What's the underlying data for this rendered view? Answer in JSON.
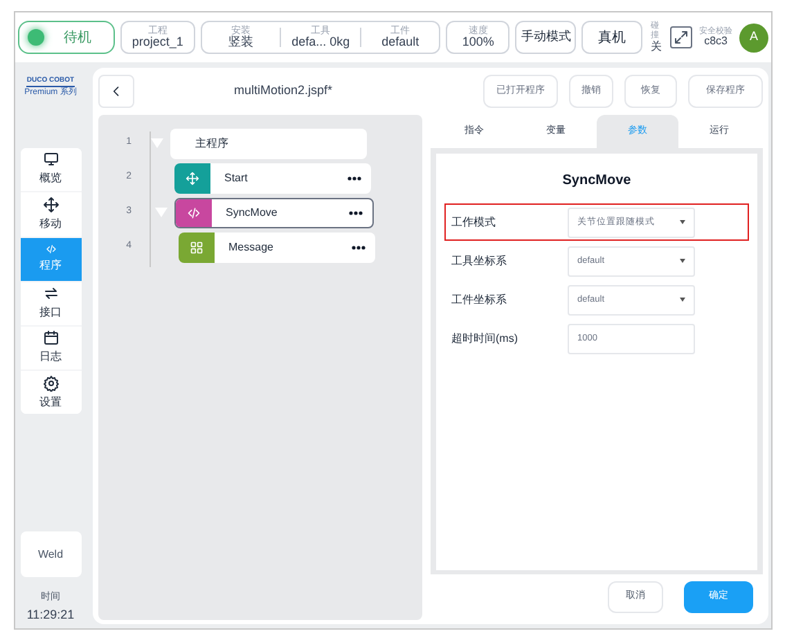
{
  "status_bar": {
    "state": {
      "label": "待机",
      "on": true
    },
    "items": [
      {
        "title": "工程",
        "value": "project_1"
      }
    ],
    "install_group": [
      {
        "title": "安装",
        "value": "竖装"
      },
      {
        "title": "工具",
        "value": "defa...   0kg"
      },
      {
        "title": "工件",
        "value": "default"
      }
    ],
    "speed": {
      "title": "速度",
      "value": "100%"
    },
    "mode_button": "手动模式",
    "machine_button": "真机",
    "collision": {
      "title": "碰撞",
      "value": "关"
    },
    "safety": {
      "title": "安全校验",
      "value": "c8c3"
    },
    "avatar": "A"
  },
  "sidebar": {
    "logo": "DUCO COBOT",
    "logo_sub": "Premium 系列",
    "items": [
      {
        "kind": "overview",
        "label": "概览",
        "selected": false
      },
      {
        "kind": "move",
        "label": "移动",
        "selected": false
      },
      {
        "kind": "program",
        "label": "程序",
        "selected": true
      },
      {
        "kind": "io",
        "label": "接口",
        "selected": false
      },
      {
        "kind": "log",
        "label": "日志",
        "selected": false
      },
      {
        "kind": "settings",
        "label": "设置",
        "selected": false
      }
    ],
    "weld": "Weld",
    "time_label": "时间",
    "time": "11:29:21"
  },
  "editor": {
    "title": "multiMotion2.jspf*",
    "buttons": [
      "已打开程序",
      "撤销",
      "恢复",
      "保存程序"
    ],
    "tree": [
      {
        "line": "1",
        "label": "主程序",
        "kind": "root",
        "expanded": true,
        "selected": false,
        "children": [
          {
            "line": "2",
            "label": "Start",
            "kind": "move",
            "color": "#14a09a",
            "selected": false
          },
          {
            "line": "3",
            "label": "SyncMove",
            "kind": "code",
            "color": "#c8479f",
            "expanded": true,
            "selected": true,
            "children": [
              {
                "line": "4",
                "label": "Message",
                "kind": "message",
                "color": "#7aa833",
                "selected": false
              }
            ]
          }
        ]
      }
    ],
    "tabs": [
      {
        "label": "指令",
        "selected": false
      },
      {
        "label": "变量",
        "selected": false
      },
      {
        "label": "参数",
        "selected": true
      },
      {
        "label": "运行",
        "selected": false
      }
    ],
    "form": {
      "title": "SyncMove",
      "fields": [
        {
          "label": "工作模式",
          "kind": "select",
          "value": "关节位置跟随模式",
          "highlighted": true
        },
        {
          "label": "工具坐标系",
          "kind": "select",
          "value": "default",
          "highlighted": false
        },
        {
          "label": "工件坐标系",
          "kind": "select",
          "value": "default",
          "highlighted": false
        },
        {
          "label": "超时时间(ms)",
          "kind": "input",
          "placeholder": "1000",
          "highlighted": false
        }
      ]
    },
    "actions": [
      "取消",
      "确定"
    ]
  }
}
